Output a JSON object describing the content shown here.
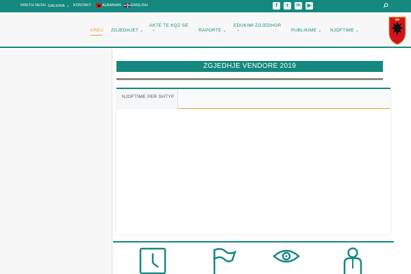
{
  "topbar": {
    "links": [
      "RRETH NESH",
      "GALERIA",
      "KONTAKT"
    ],
    "languages": [
      "ALBANIAN",
      "ENGLISH"
    ],
    "social_icons": [
      "facebook-icon",
      "twitter-icon",
      "linkedin-icon",
      "youtube-icon"
    ],
    "search_icon": "search-icon"
  },
  "nav": {
    "items": [
      {
        "label": "KREU"
      },
      {
        "label": "ZGJEDHJET"
      },
      {
        "label": "AKTE TE KQZ-SE"
      },
      {
        "label": "RAPORTE"
      },
      {
        "label": "EDUKIMI ZGJEDHOR"
      },
      {
        "label": "PUBLIKIME"
      },
      {
        "label": "NJOFTIME"
      }
    ],
    "active": "KREU"
  },
  "main": {
    "banner": "ZGJEDHJE VENDORE 2019",
    "card_tab": "NJOFTIME PER SHTYP"
  },
  "bottom_icons": [
    "clock-icon",
    "flag-icon",
    "eye-icon",
    "person-icon"
  ],
  "colors": {
    "accent": "#14887e",
    "active": "#e0a234",
    "flag_red": "#d4131f"
  }
}
